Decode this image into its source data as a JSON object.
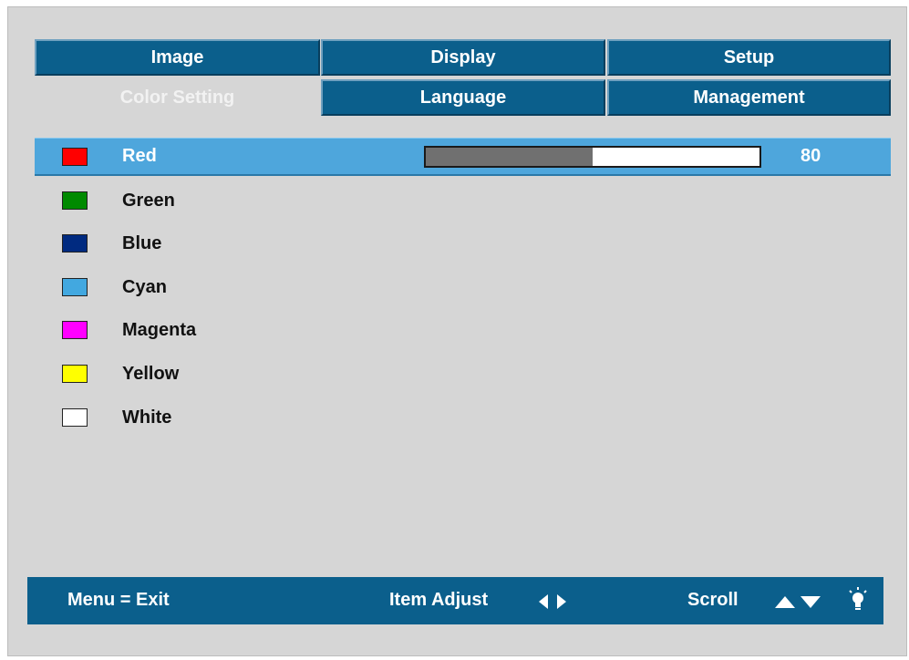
{
  "tabs": {
    "image": "Image",
    "display": "Display",
    "setup": "Setup",
    "color_setting": "Color Setting",
    "language": "Language",
    "management": "Management"
  },
  "items": [
    {
      "label": "Red",
      "swatch": "#ff0000",
      "value": 80,
      "max": 160,
      "selected": true
    },
    {
      "label": "Green",
      "swatch": "#008a00"
    },
    {
      "label": "Blue",
      "swatch": "#002a80"
    },
    {
      "label": "Cyan",
      "swatch": "#42a8e0"
    },
    {
      "label": "Magenta",
      "swatch": "#ff00ff"
    },
    {
      "label": "Yellow",
      "swatch": "#ffff00"
    },
    {
      "label": "White",
      "swatch": "#ffffff"
    }
  ],
  "selected_value": "80",
  "footer": {
    "exit": "Menu = Exit",
    "adjust": "Item Adjust",
    "scroll": "Scroll"
  },
  "colors": {
    "tab_bg": "#0b5f8c",
    "panel_bg": "#d6d6d6",
    "selected_row": "#4ea6dc"
  },
  "icons": [
    "left-right-arrows-icon",
    "up-down-arrows-icon",
    "lightbulb-icon"
  ]
}
